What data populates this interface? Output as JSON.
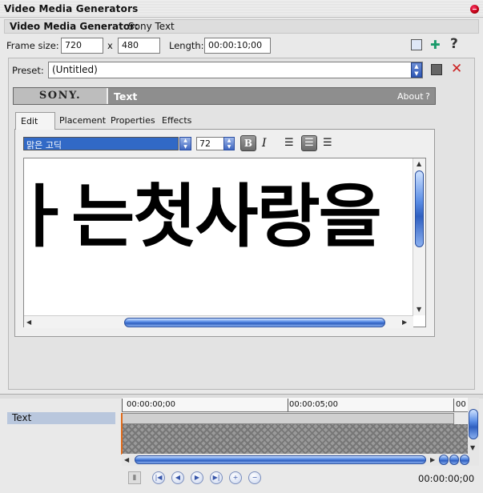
{
  "window": {
    "title": "Video Media Generators"
  },
  "generator": {
    "label": "Video Media Generator:",
    "name": "Sony Text"
  },
  "frame": {
    "size_label": "Frame size:",
    "width": "720",
    "x": "x",
    "height": "480",
    "length_label": "Length:",
    "length": "00:00:10;00"
  },
  "preset": {
    "label": "Preset:",
    "value": "(Untitled)"
  },
  "plugin": {
    "brand": "SONY.",
    "name": "Text",
    "about": "About",
    "help": "?"
  },
  "tabs": [
    "Edit",
    "Placement",
    "Properties",
    "Effects"
  ],
  "toolbar": {
    "font": "맑은 고딕",
    "size": "72",
    "bold": "B",
    "italic": "I"
  },
  "editor": {
    "text": "는첫사랑을",
    "partial_lead": "ㅏ"
  },
  "timeline": {
    "tick0": "00:00:00;00",
    "tick1": "00:00:05;00",
    "tick2": "00",
    "track": "Text",
    "current_time": "00:00:00;00"
  }
}
